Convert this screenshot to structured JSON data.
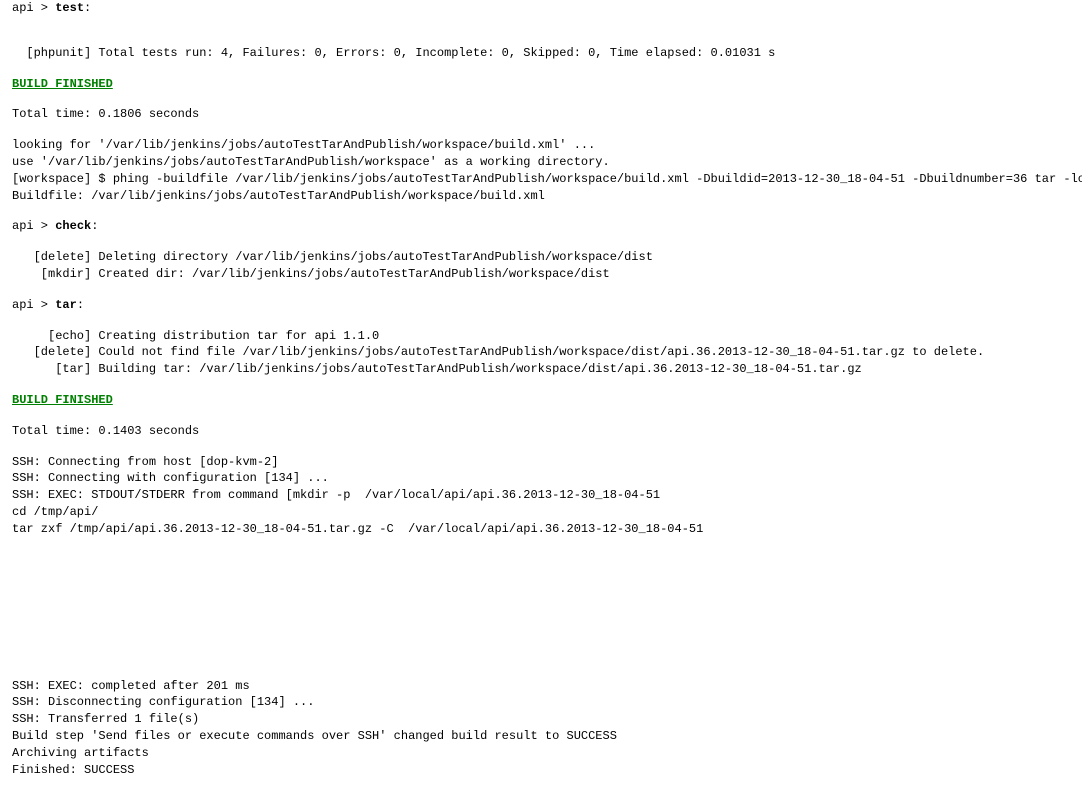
{
  "lines": [
    {
      "parts": [
        {
          "text": "api > "
        },
        {
          "text": "test",
          "bold": true
        },
        {
          "text": ":"
        }
      ]
    },
    {
      "blank": true
    },
    {
      "blank": true
    },
    {
      "parts": [
        {
          "text": "  [phpunit] Total tests run: 4, Failures: 0, Errors: 0, Incomplete: 0, Skipped: 0, Time elapsed: 0.01031 s"
        }
      ]
    },
    {
      "blank": true
    },
    {
      "parts": [
        {
          "text": "BUILD FINISHED",
          "finished": true
        }
      ]
    },
    {
      "blank": true
    },
    {
      "parts": [
        {
          "text": "Total time: 0.1806 seconds"
        }
      ]
    },
    {
      "blank": true
    },
    {
      "parts": [
        {
          "text": "looking for '/var/lib/jenkins/jobs/autoTestTarAndPublish/workspace/build.xml' ..."
        }
      ]
    },
    {
      "parts": [
        {
          "text": "use '/var/lib/jenkins/jobs/autoTestTarAndPublish/workspace' as a working directory."
        }
      ]
    },
    {
      "parts": [
        {
          "text": "[workspace] $ phing -buildfile /var/lib/jenkins/jobs/autoTestTarAndPublish/workspace/build.xml -Dbuildid=2013-12-30_18-04-51 -Dbuildnumber=36 tar -logger phing.listener.DefaultLo"
        }
      ]
    },
    {
      "parts": [
        {
          "text": "Buildfile: /var/lib/jenkins/jobs/autoTestTarAndPublish/workspace/build.xml"
        }
      ]
    },
    {
      "blank": true
    },
    {
      "parts": [
        {
          "text": "api > "
        },
        {
          "text": "check",
          "bold": true
        },
        {
          "text": ":"
        }
      ]
    },
    {
      "blank": true
    },
    {
      "parts": [
        {
          "text": "   [delete] Deleting directory /var/lib/jenkins/jobs/autoTestTarAndPublish/workspace/dist"
        }
      ]
    },
    {
      "parts": [
        {
          "text": "    [mkdir] Created dir: /var/lib/jenkins/jobs/autoTestTarAndPublish/workspace/dist"
        }
      ]
    },
    {
      "blank": true
    },
    {
      "parts": [
        {
          "text": "api > "
        },
        {
          "text": "tar",
          "bold": true
        },
        {
          "text": ":"
        }
      ]
    },
    {
      "blank": true
    },
    {
      "parts": [
        {
          "text": "     [echo] Creating distribution tar for api 1.1.0"
        }
      ]
    },
    {
      "parts": [
        {
          "text": "   [delete] Could not find file /var/lib/jenkins/jobs/autoTestTarAndPublish/workspace/dist/api.36.2013-12-30_18-04-51.tar.gz to delete."
        }
      ]
    },
    {
      "parts": [
        {
          "text": "      [tar] Building tar: /var/lib/jenkins/jobs/autoTestTarAndPublish/workspace/dist/api.36.2013-12-30_18-04-51.tar.gz"
        }
      ]
    },
    {
      "blank": true
    },
    {
      "parts": [
        {
          "text": "BUILD FINISHED",
          "finished": true
        }
      ]
    },
    {
      "blank": true
    },
    {
      "parts": [
        {
          "text": "Total time: 0.1403 seconds"
        }
      ]
    },
    {
      "blank": true
    },
    {
      "parts": [
        {
          "text": "SSH: Connecting from host [dop-kvm-2]"
        }
      ]
    },
    {
      "parts": [
        {
          "text": "SSH: Connecting with configuration [134] ..."
        }
      ]
    },
    {
      "parts": [
        {
          "text": "SSH: EXEC: STDOUT/STDERR from command [mkdir -p  /var/local/api/api.36.2013-12-30_18-04-51"
        }
      ]
    },
    {
      "parts": [
        {
          "text": "cd /tmp/api/"
        }
      ]
    },
    {
      "parts": [
        {
          "text": "tar zxf /tmp/api/api.36.2013-12-30_18-04-51.tar.gz -C  /var/local/api/api.36.2013-12-30_18-04-51"
        }
      ]
    },
    {
      "biggap": true
    },
    {
      "parts": [
        {
          "text": "SSH: EXEC: completed after 201 ms"
        }
      ]
    },
    {
      "parts": [
        {
          "text": "SSH: Disconnecting configuration [134] ..."
        }
      ]
    },
    {
      "parts": [
        {
          "text": "SSH: Transferred 1 file(s)"
        }
      ]
    },
    {
      "parts": [
        {
          "text": "Build step 'Send files or execute commands over SSH' changed build result to SUCCESS"
        }
      ]
    },
    {
      "parts": [
        {
          "text": "Archiving artifacts"
        }
      ]
    },
    {
      "parts": [
        {
          "text": "Finished: SUCCESS"
        }
      ]
    }
  ]
}
